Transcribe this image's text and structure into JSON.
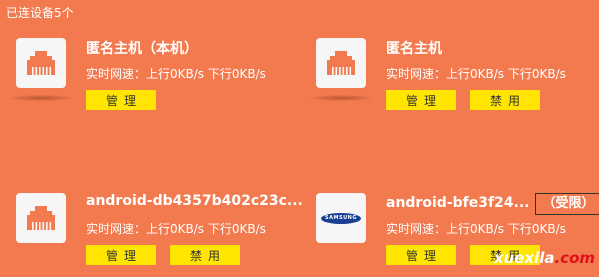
{
  "header": {
    "title": "已连设备5个"
  },
  "devices": [
    {
      "name": "匿名主机（本机）",
      "icon": "ethernet-port-icon",
      "speed_label": "实时网速：",
      "upload": "上行0KB/s",
      "download": "下行0KB/s",
      "manage_label": "管理",
      "disable_label": ""
    },
    {
      "name": "匿名主机",
      "icon": "ethernet-port-icon",
      "speed_label": "实时网速：",
      "upload": "上行0KB/s",
      "download": "下行0KB/s",
      "manage_label": "管理",
      "disable_label": "禁用"
    },
    {
      "name": "android-db4357b402c23c...",
      "icon": "ethernet-port-icon",
      "speed_label": "实时网速：",
      "upload": "上行0KB/s",
      "download": "下行0KB/s",
      "manage_label": "管理",
      "disable_label": "禁用"
    },
    {
      "name": "android-bfe3f24...",
      "badge": "（受限）",
      "icon": "samsung-logo-icon",
      "logo_text": "SAMSUNG",
      "speed_label": "实时网速：",
      "upload": "上行0KB/s",
      "download": "下行0KB/s",
      "manage_label": "管理",
      "disable_label": "禁用"
    }
  ],
  "watermark": {
    "main": "xuexila",
    "dot": ".",
    "tld": "com"
  },
  "colors": {
    "background": "#f27a4e",
    "button": "#ffe500",
    "port_icon": "#f27a4e"
  }
}
